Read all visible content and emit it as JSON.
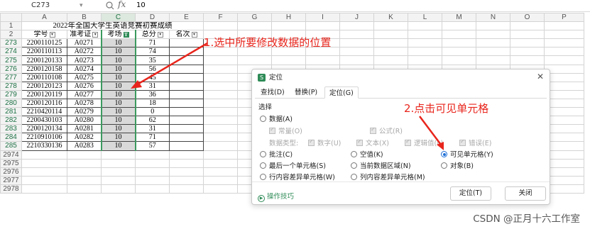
{
  "formula_bar": {
    "name_box": "C273",
    "fx_label": "fx",
    "value": "10"
  },
  "columns": [
    "A",
    "B",
    "C",
    "D",
    "E",
    "F",
    "G",
    "H",
    "I",
    "J",
    "K",
    "L",
    "M",
    "N",
    "O",
    "P"
  ],
  "row_numbers": [
    "1",
    "2",
    "273",
    "274",
    "275",
    "276",
    "277",
    "278",
    "279",
    "280",
    "281",
    "282",
    "283",
    "284",
    "285",
    "2974",
    "2975",
    "2976",
    "2977",
    "2978"
  ],
  "table": {
    "title": "2022年全国大学生英语竞赛初赛成绩",
    "headers": [
      "学号",
      "准考证",
      "考场",
      "总分",
      "名次"
    ],
    "rows": [
      [
        "2200110125",
        "A0271",
        "10",
        "71"
      ],
      [
        "2200110113",
        "A0272",
        "10",
        "74"
      ],
      [
        "2200120133",
        "A0273",
        "10",
        "35"
      ],
      [
        "2200120158",
        "A0274",
        "10",
        "56"
      ],
      [
        "2200110108",
        "A0275",
        "10",
        "45"
      ],
      [
        "2200120123",
        "A0276",
        "10",
        "31"
      ],
      [
        "2200120119",
        "A0277",
        "10",
        "36"
      ],
      [
        "2200120116",
        "A0278",
        "10",
        "18"
      ],
      [
        "2210420114",
        "A0279",
        "10",
        "0"
      ],
      [
        "2200430103",
        "A0280",
        "10",
        "62"
      ],
      [
        "2200120134",
        "A0281",
        "10",
        "31"
      ],
      [
        "2210910106",
        "A0282",
        "10",
        "71"
      ],
      [
        "2210330136",
        "A0283",
        "10",
        "57"
      ]
    ]
  },
  "annotations": {
    "step1": "1.选中所要修改数据的位置",
    "step2": "2.点击可见单元格"
  },
  "dialog": {
    "title": "定位",
    "tabs": [
      "查找(D)",
      "替换(P)",
      "定位(G)"
    ],
    "section": "选择",
    "options": {
      "data": "数据(A)",
      "constants": "常量(O)",
      "formulas": "公式(R)",
      "data_type_label": "数据类型:",
      "number": "数字(U)",
      "text": "文本(X)",
      "logical": "逻辑值(L)",
      "error": "错误(E)",
      "comments": "批注(C)",
      "blanks": "空值(K)",
      "visible_cells": "可见单元格(Y)",
      "last_cell": "最后一个单元格(S)",
      "current_region": "当前数据区域(N)",
      "objects": "对象(B)",
      "row_diff": "行内容差异单元格(W)",
      "col_diff": "列内容差异单元格(M)"
    },
    "tips": "操作技巧",
    "goto_button": "定位(T)",
    "close_button": "关闭"
  },
  "watermark": "CSDN @正月十六工作室",
  "colors": {
    "accent_green": "#2e8b57",
    "annotation_red": "#e8251c",
    "radio_blue": "#1f6fd6"
  }
}
